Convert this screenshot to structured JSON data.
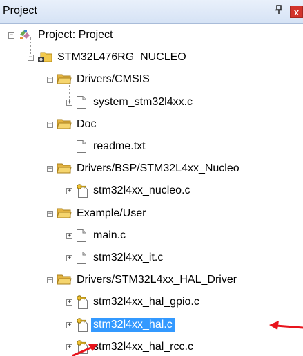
{
  "window": {
    "title": "Project",
    "pin_glyph": "ф",
    "close_glyph": "x"
  },
  "tree": {
    "root": {
      "label": "Project: Project",
      "icon": "project-icon",
      "expanded": true
    },
    "target": {
      "label": "STM32L476RG_NUCLEO",
      "icon": "target-icon",
      "expanded": true
    },
    "groups": [
      {
        "label": "Drivers/CMSIS",
        "expanded": true,
        "files": [
          {
            "label": "system_stm32l4xx.c",
            "icon": "file-icon",
            "expandable": true
          }
        ]
      },
      {
        "label": "Doc",
        "expanded": true,
        "files": [
          {
            "label": "readme.txt",
            "icon": "file-icon",
            "expandable": false
          }
        ]
      },
      {
        "label": "Drivers/BSP/STM32L4xx_Nucleo",
        "expanded": true,
        "files": [
          {
            "label": "stm32l4xx_nucleo.c",
            "icon": "key-file-icon",
            "expandable": true
          }
        ]
      },
      {
        "label": "Example/User",
        "expanded": true,
        "files": [
          {
            "label": "main.c",
            "icon": "file-icon",
            "expandable": true
          },
          {
            "label": "stm32l4xx_it.c",
            "icon": "file-icon",
            "expandable": true
          }
        ]
      },
      {
        "label": "Drivers/STM32L4xx_HAL_Driver",
        "expanded": true,
        "files": [
          {
            "label": "stm32l4xx_hal_gpio.c",
            "icon": "key-file-icon",
            "expandable": true
          },
          {
            "label": "stm32l4xx_hal.c",
            "icon": "key-file-icon",
            "expandable": true,
            "selected": true
          },
          {
            "label": "stm32l4xx_hal_rcc.c",
            "icon": "key-file-icon",
            "expandable": true
          }
        ]
      }
    ]
  },
  "colors": {
    "selection": "#3399ff",
    "arrow": "#e8141c",
    "folder": "#f2c94c"
  }
}
